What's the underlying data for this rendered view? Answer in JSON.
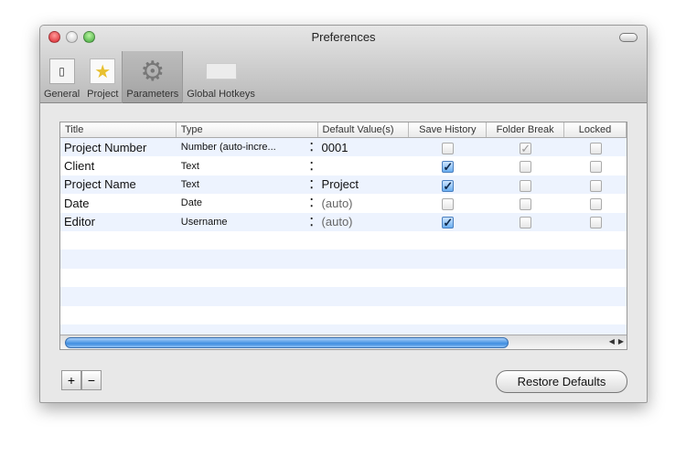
{
  "window": {
    "title": "Preferences"
  },
  "toolbar": [
    {
      "label": "General"
    },
    {
      "label": "Project"
    },
    {
      "label": "Parameters"
    },
    {
      "label": "Global Hotkeys"
    }
  ],
  "table": {
    "headers": [
      "Title",
      "Type",
      "Default Value(s)",
      "Save History",
      "Folder Break",
      "Locked"
    ],
    "rows": [
      {
        "title": "Project Number",
        "type": "Number (auto-incre...",
        "default": "0001",
        "save_history": false,
        "folder_break": true,
        "locked": false
      },
      {
        "title": "Client",
        "type": "Text",
        "default": "",
        "save_history": true,
        "folder_break": false,
        "locked": false
      },
      {
        "title": "Project Name",
        "type": "Text",
        "default": "Project",
        "save_history": true,
        "folder_break": false,
        "locked": false
      },
      {
        "title": "Date",
        "type": "Date",
        "default": "(auto)",
        "save_history": false,
        "folder_break": false,
        "locked": false
      },
      {
        "title": "Editor",
        "type": "Username",
        "default": "(auto)",
        "save_history": true,
        "folder_break": false,
        "locked": false
      }
    ]
  },
  "buttons": {
    "add": "+",
    "remove": "−",
    "restore": "Restore Defaults"
  },
  "colors": {
    "accent": "#3f8de0",
    "row_alt": "#edf3fe"
  }
}
